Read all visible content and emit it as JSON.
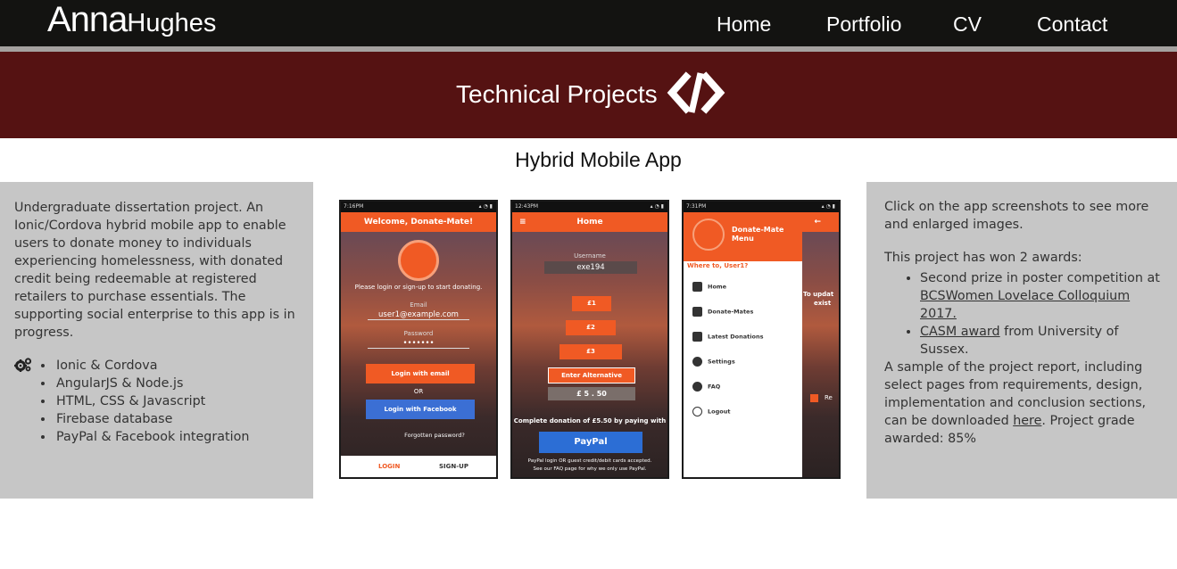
{
  "nav": {
    "brand_first": "Anna",
    "brand_last": "Hughes",
    "links": [
      "Home",
      "Portfolio",
      "CV",
      "Contact"
    ]
  },
  "banner": {
    "title": "Technical Projects",
    "icon": "code-icon"
  },
  "project": {
    "title": "Hybrid Mobile App",
    "description": "Undergraduate dissertation project. An Ionic/Cordova hybrid mobile app to enable users to donate money to individuals experiencing homelessness, with donated credit being redeemable at registered retailers to purchase essentials. The supporting social enterprise to this app is in progress.",
    "tech_icon": "gears-icon",
    "tech": [
      "Ionic & Cordova",
      "AngularJS & Node.js",
      "HTML, CSS & Javascript",
      "Firebase database",
      "PayPal & Facebook integration"
    ]
  },
  "info": {
    "click_note": "Click on the app screenshots to see more and enlarged images.",
    "awards_intro": "This project has won 2 awards:",
    "award1_prefix": "Second prize in poster competition at",
    "award1_link": "BCSWomen Lovelace Colloquium 2017.",
    "award2_link": "CASM award",
    "award2_suffix": " from University of Sussex.",
    "sample_text": "A sample of the project report, including select pages from requirements, design, implementation and conclusion sections, can be downloaded ",
    "sample_link": "here",
    "grade_text": ". Project grade awarded: 85%"
  },
  "screens": {
    "s1": {
      "time": "7:16PM",
      "header": "Welcome, Donate-Mate!",
      "prompt": "Please login or sign-up to start donating.",
      "email_label": "Email",
      "email_value": "user1@example.com",
      "password_label": "Password",
      "password_value": "•••••••",
      "login_email": "Login with email",
      "or": "OR",
      "login_facebook": "Login with Facebook",
      "forgot": "Forgotten password?",
      "tab_login": "LOGIN",
      "tab_signup": "SIGN-UP"
    },
    "s2": {
      "time": "12:43PM",
      "header": "Home",
      "username_label": "Username",
      "username_value": "exe194",
      "amounts": [
        "£1",
        "£2",
        "£3"
      ],
      "alt": "Enter Alternative",
      "currency": "£",
      "pounds": "5",
      "dot": ".",
      "pence": "50",
      "complete": "Complete donation of £5.50 by paying with",
      "paypal": "PayPal",
      "note1": "PayPal login OR guest credit/debit cards accepted.",
      "note2": "See our FAQ page for why we only use PayPal."
    },
    "s3": {
      "time": "7:31PM",
      "menu_title": "Donate-Mate Menu",
      "where": "Where to, User1?",
      "items": [
        "Home",
        "Donate-Mates",
        "Latest Donations",
        "Settings",
        "FAQ",
        "Logout"
      ],
      "peek1": "To updat",
      "peek2": "exist",
      "peek3": "Re"
    }
  },
  "colors": {
    "nav_bg": "#131311",
    "banner_bg": "#551212",
    "panel_bg": "#c6c6c6",
    "app_orange": "#f05a24",
    "facebook_blue": "#3b6fd4"
  }
}
